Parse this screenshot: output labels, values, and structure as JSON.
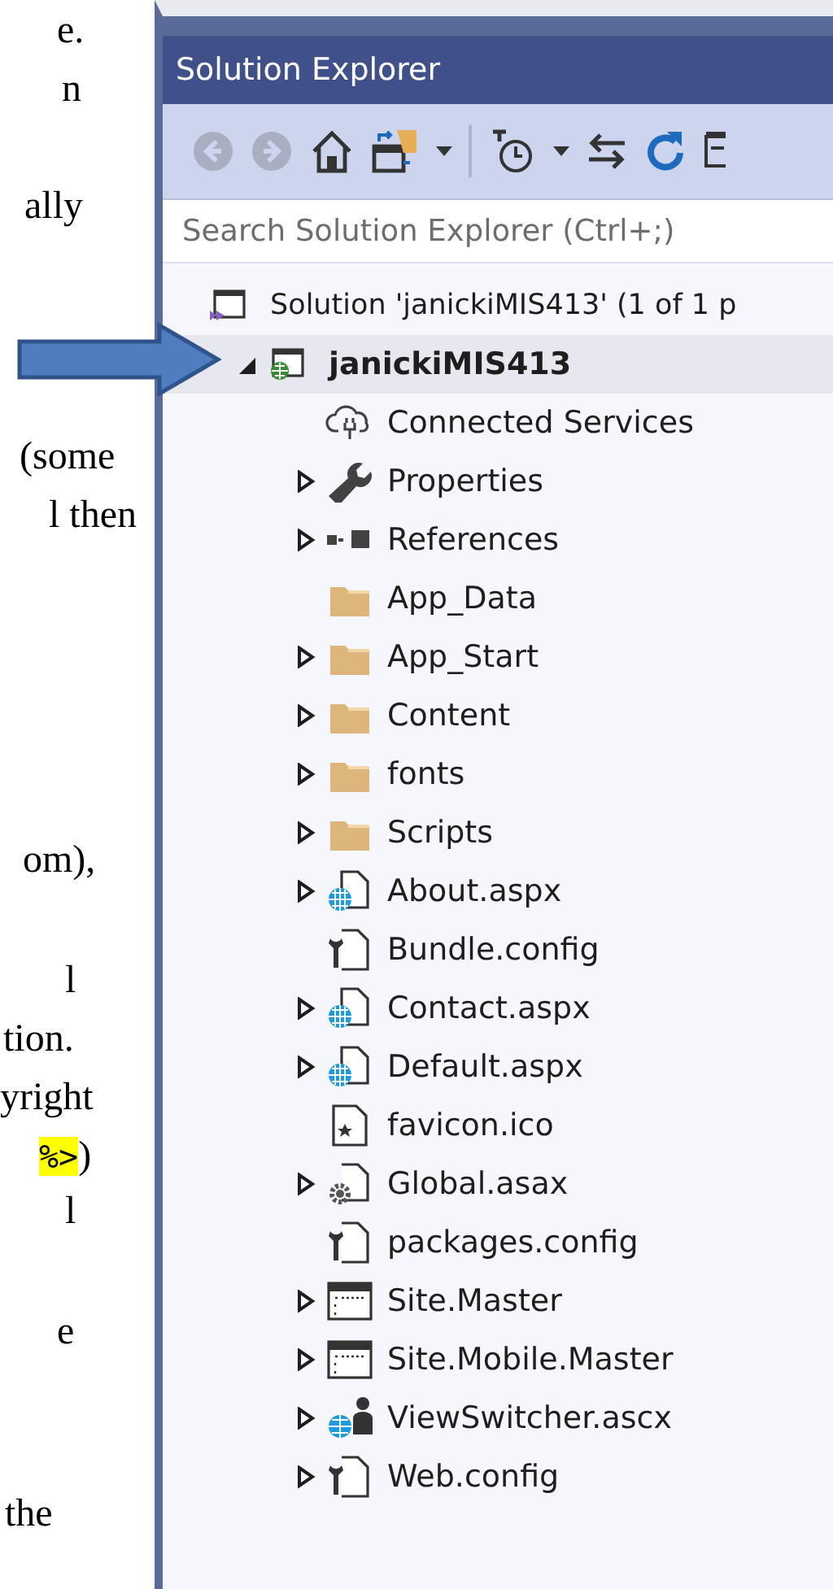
{
  "document_lines": [
    {
      "text": "e."
    },
    {
      "text": "n"
    },
    {
      "text": "ally"
    },
    {
      "text": "(some"
    },
    {
      "text": "l then"
    },
    {
      "text": "om),"
    },
    {
      "text": "l"
    },
    {
      "text": "tion."
    },
    {
      "text": "yright"
    },
    {
      "parts": [
        {
          "text": "%>",
          "highlighted": true
        },
        {
          "text": ")",
          "highlighted": false
        }
      ]
    },
    {
      "text": "l"
    },
    {
      "text": "e"
    },
    {
      "text": "the"
    }
  ],
  "solution_explorer": {
    "title": "Solution Explorer",
    "search": {
      "placeholder": "Search Solution Explorer (Ctrl+;)"
    },
    "tree": [
      {
        "label": "Solution 'janickiMIS413' (1 of 1 p",
        "kind": "solution",
        "selected": false,
        "children": [
          {
            "label": "janickiMIS413",
            "kind": "web-project",
            "selected": true,
            "expanded": true,
            "children": [
              {
                "label": "Connected Services",
                "kind": "cloud",
                "selected": false
              },
              {
                "label": "Properties",
                "kind": "wrench",
                "selected": false,
                "expanded": false
              },
              {
                "label": "References",
                "kind": "references",
                "selected": false,
                "expanded": false
              },
              {
                "label": "App_Data",
                "kind": "folder",
                "selected": false
              },
              {
                "label": "App_Start",
                "kind": "folder",
                "selected": false,
                "expanded": false
              },
              {
                "label": "Content",
                "kind": "folder",
                "selected": false,
                "expanded": false
              },
              {
                "label": "fonts",
                "kind": "folder",
                "selected": false,
                "expanded": false
              },
              {
                "label": "Scripts",
                "kind": "folder",
                "selected": false,
                "expanded": false
              },
              {
                "label": "About.aspx",
                "kind": "web-file",
                "selected": false,
                "expanded": false
              },
              {
                "label": "Bundle.config",
                "kind": "config",
                "selected": false
              },
              {
                "label": "Contact.aspx",
                "kind": "web-file",
                "selected": false,
                "expanded": false
              },
              {
                "label": "Default.aspx",
                "kind": "web-file",
                "selected": false,
                "expanded": false
              },
              {
                "label": "favicon.ico",
                "kind": "icon-file",
                "selected": false
              },
              {
                "label": "Global.asax",
                "kind": "gear-file",
                "selected": false,
                "expanded": false
              },
              {
                "label": "packages.config",
                "kind": "config",
                "selected": false
              },
              {
                "label": "Site.Master",
                "kind": "master",
                "selected": false,
                "expanded": false
              },
              {
                "label": "Site.Mobile.Master",
                "kind": "master",
                "selected": false,
                "expanded": false
              },
              {
                "label": "ViewSwitcher.ascx",
                "kind": "user-control",
                "selected": false,
                "expanded": false
              },
              {
                "label": "Web.config",
                "kind": "config",
                "selected": false,
                "expanded": false
              }
            ]
          }
        ]
      }
    ]
  }
}
